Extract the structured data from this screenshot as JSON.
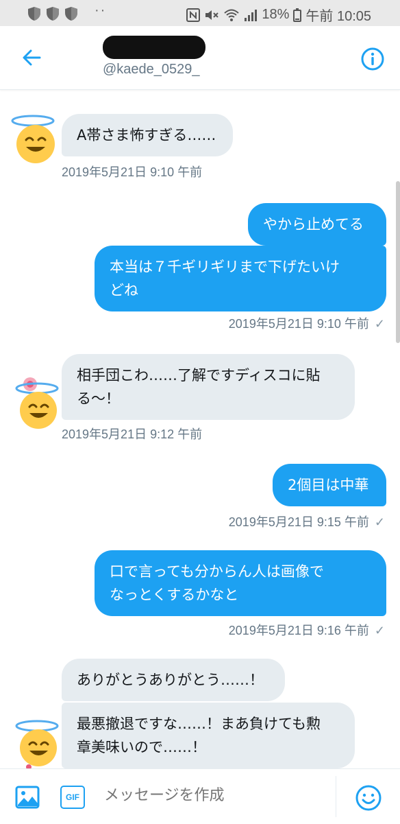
{
  "status_bar": {
    "icons": [
      "shield-icon",
      "shield-icon",
      "shield-icon",
      "more-icon",
      "nfc-icon",
      "mute-icon",
      "wifi-icon",
      "signal-icon",
      "battery-icon"
    ],
    "dots": "··",
    "battery": "18%",
    "time": "午前 10:05"
  },
  "header": {
    "handle": "@kaede_0529_",
    "name_visible_fragment": ")",
    "accent_color": "#1da1f2"
  },
  "messages": [
    {
      "direction": "in",
      "text_lines": [
        "A帯さま怖すぎる……"
      ],
      "timestamp": "2019年5月21日 9:10 午前"
    },
    {
      "direction": "out",
      "text_lines": [
        "やから止めてる"
      ]
    },
    {
      "direction": "out",
      "text_lines": [
        "本当は７千ギリギリまで下げたいけ",
        "どね"
      ],
      "timestamp": "2019年5月21日 9:10 午前"
    },
    {
      "direction": "in",
      "text_lines": [
        "相手団こわ……了解ですディスコに貼",
        "る～！"
      ],
      "timestamp": "2019年5月21日 9:12 午前"
    },
    {
      "direction": "out",
      "text_lines": [
        "2個目は中華"
      ],
      "timestamp": "2019年5月21日 9:15 午前"
    },
    {
      "direction": "out",
      "text_lines": [
        "口で言っても分からん人は画像で",
        "なっとくするかなと"
      ],
      "timestamp": "2019年5月21日 9:16 午前"
    },
    {
      "direction": "in",
      "text_lines": [
        "ありがとうありがとう……！"
      ]
    },
    {
      "direction": "in",
      "text_lines": [
        "最悪撤退ですな……！まあ負けても勲",
        "章美味いので……！"
      ]
    }
  ],
  "read_check": "✓",
  "composer": {
    "placeholder": "メッセージを作成",
    "gif_label": "GIF"
  },
  "colors": {
    "incoming_bubble": "#e6ecf0",
    "outgoing_bubble": "#1da1f2",
    "timestamp": "#657786"
  }
}
